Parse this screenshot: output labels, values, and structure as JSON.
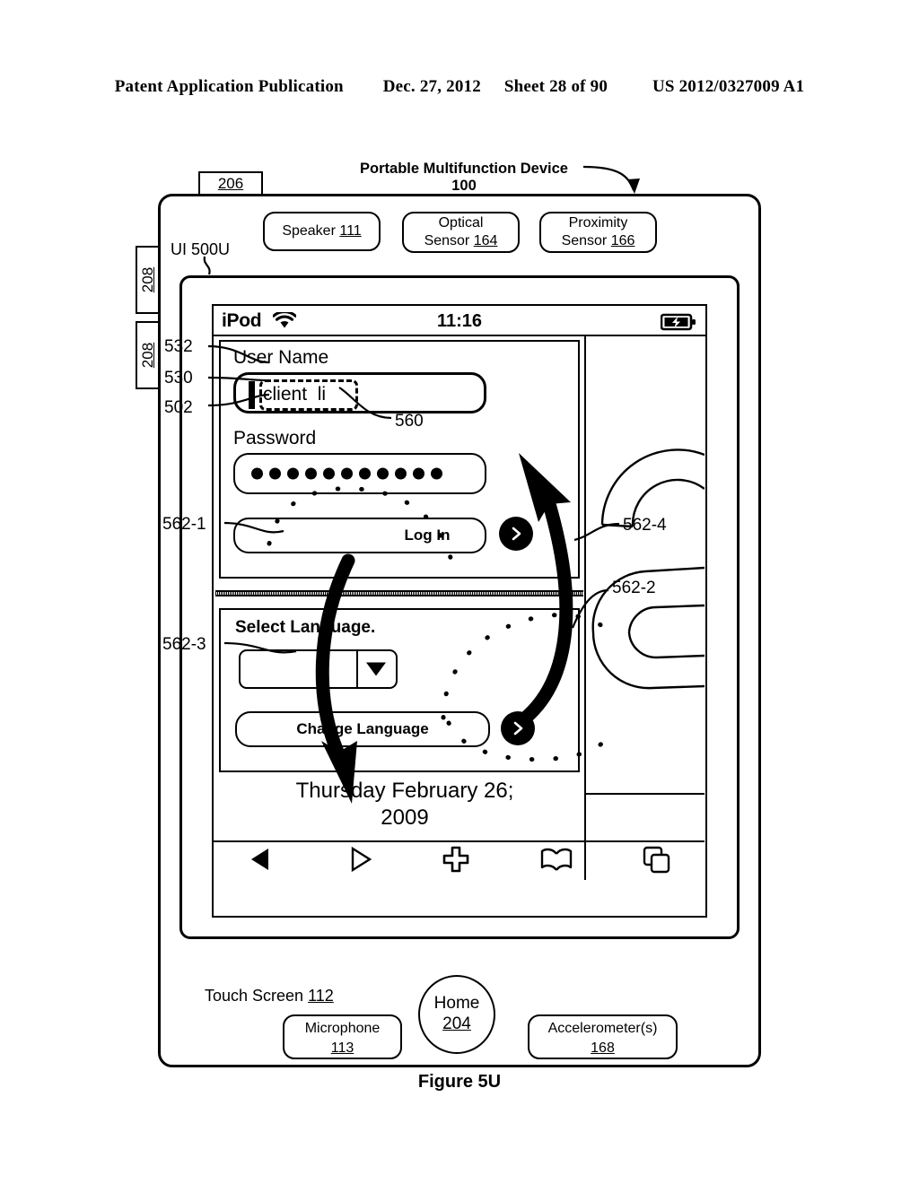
{
  "patent_header": {
    "publication": "Patent Application Publication",
    "date": "Dec. 27, 2012",
    "sheet": "Sheet 28 of 90",
    "number": "US 2012/0327009 A1"
  },
  "figure": {
    "caption": "Figure 5U",
    "device_title": "Portable Multifunction Device",
    "device_number": "100",
    "ui_label": "UI 500U",
    "tab_206": "206",
    "tab_208_a": "208",
    "tab_208_b": "208"
  },
  "sensors": {
    "speaker": {
      "name": "Speaker",
      "number": "111"
    },
    "optical": {
      "name": "Optical",
      "name2": "Sensor",
      "number": "164"
    },
    "proximity": {
      "name": "Proximity",
      "name2": "Sensor",
      "number": "166"
    }
  },
  "status_bar": {
    "carrier": "iPod",
    "wifi_icon": "wifi-icon",
    "time": "11:16",
    "battery_icon": "battery-charging-icon"
  },
  "web_form": {
    "username_label": "User Name",
    "username_value": "client  li",
    "password_label": "Password",
    "password_dots": 11,
    "login_button": "Log In",
    "select_language_label": "Select Language.",
    "language_value": "",
    "change_language_button": "Change Language",
    "date_line1": "Thursday February 26;",
    "date_line2": "2009"
  },
  "toolbar": {
    "items": [
      {
        "name": "back-icon",
        "label": "Back"
      },
      {
        "name": "forward-icon",
        "label": "Forward"
      },
      {
        "name": "plus-icon",
        "label": "Add"
      },
      {
        "name": "bookmarks-icon",
        "label": "Bookmarks"
      },
      {
        "name": "pages-icon",
        "label": "Pages"
      }
    ]
  },
  "device_bottom": {
    "touch_screen_label": "Touch Screen",
    "touch_screen_number": "112",
    "home_label": "Home",
    "home_number": "204",
    "microphone_label": "Microphone",
    "microphone_number": "113",
    "accelerometer_label": "Accelerometer(s)",
    "accelerometer_number": "168"
  },
  "reference_numbers": {
    "r532": "532",
    "r530": "530",
    "r502": "502",
    "r560": "560",
    "r562_1": "562-1",
    "r562_2": "562-2",
    "r562_3": "562-3",
    "r562_4": "562-4"
  },
  "colors": {
    "ink": "#000000",
    "paper": "#ffffff"
  }
}
